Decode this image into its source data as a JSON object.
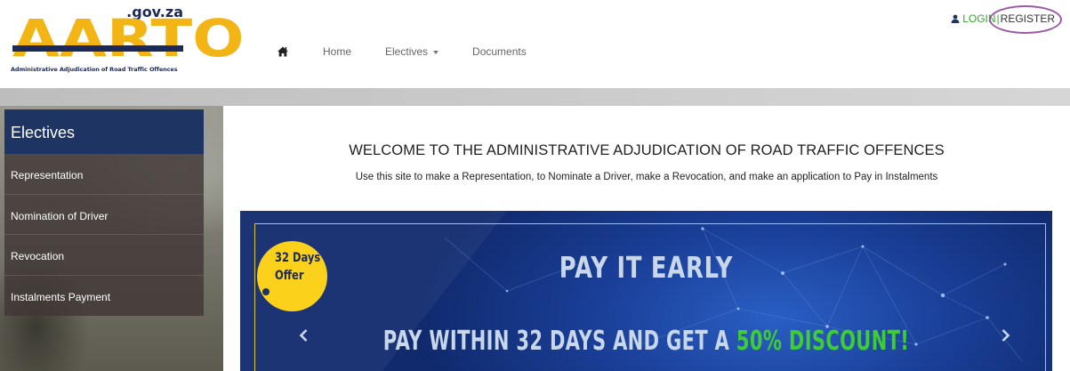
{
  "brand": {
    "domain_suffix": ".gov.za",
    "wordmark": "AARTO",
    "tagline": "Administrative Adjudication of Road Traffic Offences",
    "colors": {
      "yellow": "#f3b515",
      "navy": "#1c2a59"
    }
  },
  "nav": {
    "home_icon": "home-icon",
    "items": [
      {
        "label": "Home"
      },
      {
        "label": "Electives",
        "has_dropdown": true
      },
      {
        "label": "Documents"
      }
    ]
  },
  "auth": {
    "user_icon": "user-icon",
    "login_label": "LOGIN",
    "separator": "|",
    "register_label": "REGISTER",
    "highlight_color": "#9b59a6"
  },
  "sidebar": {
    "title": "Electives",
    "items": [
      {
        "label": "Representation"
      },
      {
        "label": "Nomination of Driver"
      },
      {
        "label": "Revocation"
      },
      {
        "label": "Instalments Payment"
      }
    ],
    "colors": {
      "header": "#1e3563"
    }
  },
  "main": {
    "heading": "WELCOME TO THE ADMINISTRATIVE ADJUDICATION OF ROAD TRAFFIC OFFENCES",
    "subheading": "Use this site to make a Representation, to Nominate a Driver, make a Revocation, and make an application to Pay in Instalments"
  },
  "banner": {
    "badge_line1": "32 Days",
    "badge_line2": "Offer",
    "headline": "PAY IT EARLY",
    "offer_text": "PAY WITHIN 32 DAYS AND GET A ",
    "offer_highlight": "50% DISCOUNT!",
    "prev_icon": "chevron-left-icon",
    "next_icon": "chevron-right-icon",
    "colors": {
      "badge": "#fbd11b",
      "highlight": "#3fcc36",
      "text": "#c9d7ea"
    }
  }
}
